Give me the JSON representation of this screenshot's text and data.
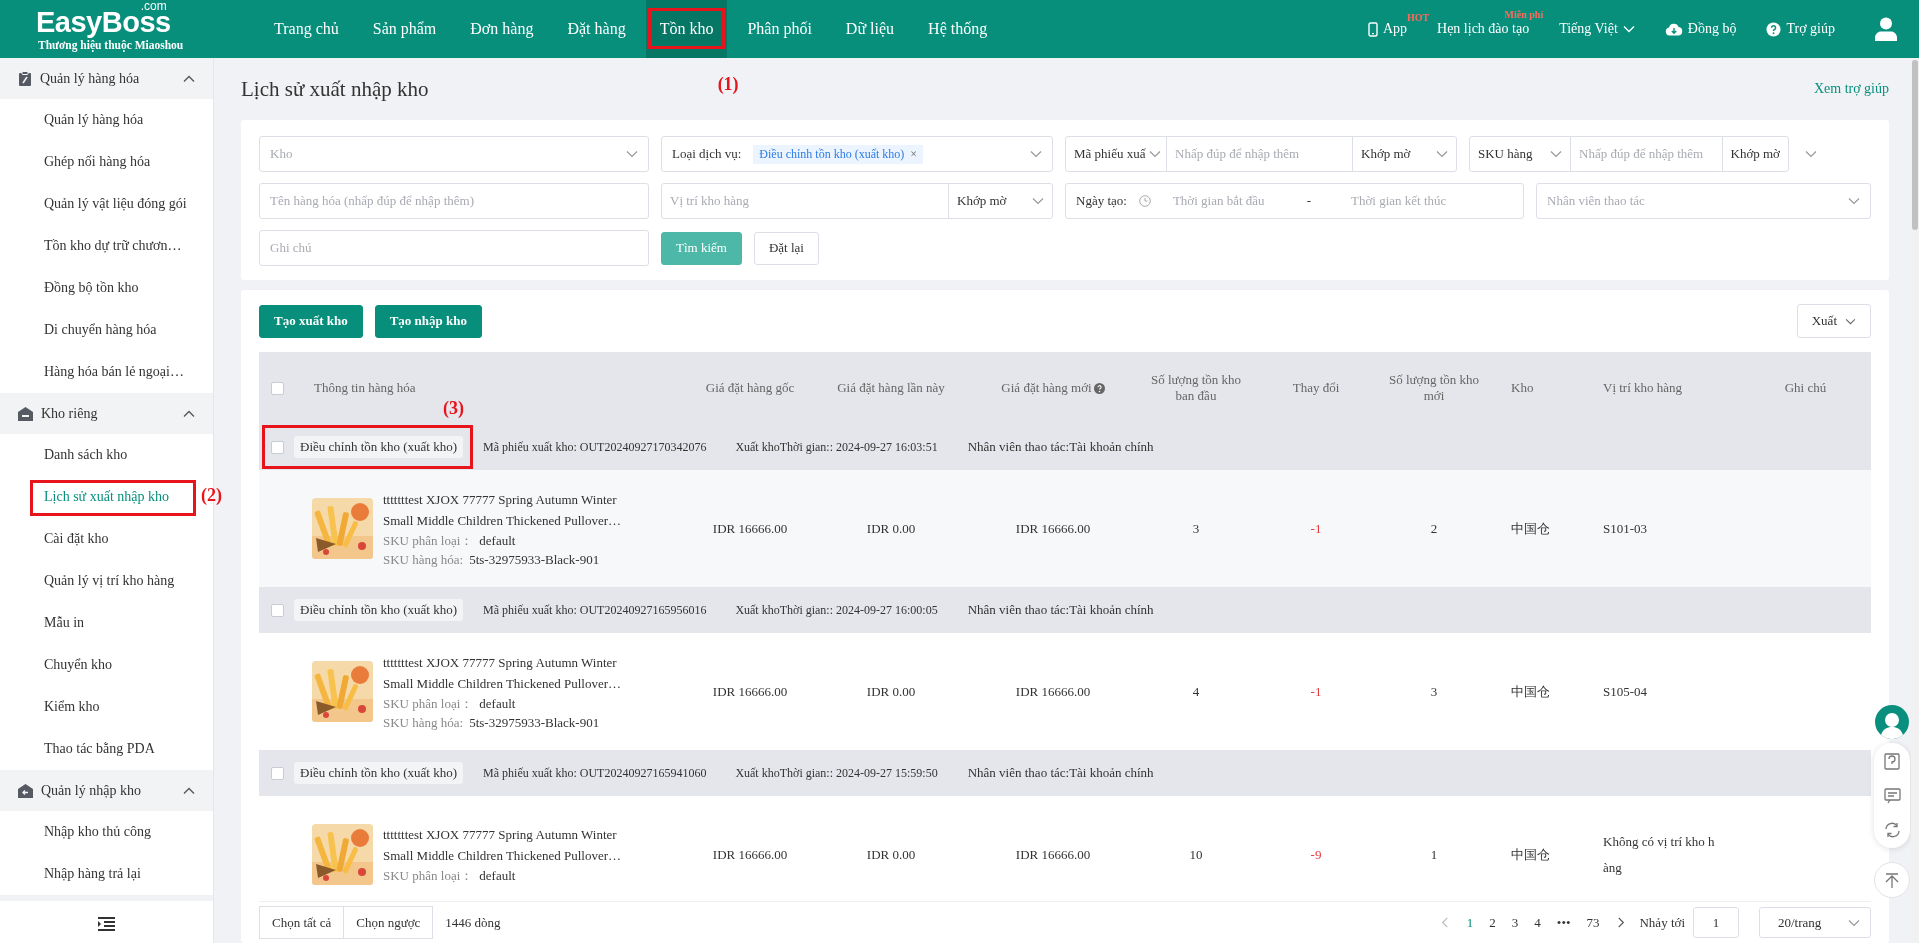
{
  "header": {
    "logo": "EasyBoss",
    "logo_suffix": ".com",
    "tagline": "Thương hiệu thuộc Miaoshou",
    "nav": [
      {
        "label": "Trang chủ",
        "selected": false
      },
      {
        "label": "Sản phẩm",
        "selected": false
      },
      {
        "label": "Đơn hàng",
        "selected": false
      },
      {
        "label": "Đặt hàng",
        "selected": false
      },
      {
        "label": "Tồn kho",
        "selected": true,
        "callout": "(1)"
      },
      {
        "label": "Phân phối",
        "selected": false
      },
      {
        "label": "Dữ liệu",
        "selected": false
      },
      {
        "label": "Hệ thống",
        "selected": false
      }
    ],
    "tools": [
      {
        "kind": "app",
        "label": "App",
        "badge": "HOT"
      },
      {
        "kind": "plain",
        "label": "Hẹn lịch đào tạo",
        "badge": "Miễn phí"
      },
      {
        "kind": "dropdown",
        "label": "Tiếng Việt"
      },
      {
        "kind": "sync",
        "label": "Đồng bộ"
      },
      {
        "kind": "help",
        "label": "Trợ giúp"
      }
    ]
  },
  "sidebar": {
    "groups": [
      {
        "kind": "goods",
        "label": "Quản lý hàng hóa",
        "expanded": true,
        "items": [
          {
            "label": "Quản lý hàng hóa",
            "selected": false
          },
          {
            "label": "Ghép nối hàng hóa",
            "selected": false
          },
          {
            "label": "Quản lý vật liệu đóng gói",
            "selected": false
          },
          {
            "label": "Tồn kho dự trữ chươn…",
            "selected": false
          },
          {
            "label": "Đồng bộ tồn kho",
            "selected": false
          },
          {
            "label": "Di chuyển hàng hóa",
            "selected": false
          },
          {
            "label": "Hàng hóa bán lẻ ngoại…",
            "selected": false
          }
        ]
      },
      {
        "kind": "warehouse",
        "label": "Kho riêng",
        "expanded": true,
        "items": [
          {
            "label": "Danh sách kho",
            "selected": false
          },
          {
            "label": "Lịch sử xuất nhập kho",
            "selected": true,
            "callout": "(2)"
          },
          {
            "label": "Cài đặt kho",
            "selected": false
          },
          {
            "label": "Quản lý vị trí kho hàng",
            "selected": false
          },
          {
            "label": "Mẫu in",
            "selected": false
          },
          {
            "label": "Chuyển kho",
            "selected": false
          },
          {
            "label": "Kiểm kho",
            "selected": false
          },
          {
            "label": "Thao tác bằng PDA",
            "selected": false
          }
        ]
      },
      {
        "kind": "inbound",
        "label": "Quản lý nhập kho",
        "expanded": true,
        "items": [
          {
            "label": "Nhập kho thủ công",
            "selected": false
          },
          {
            "label": "Nhập hàng trả lại",
            "selected": false
          }
        ]
      }
    ]
  },
  "page": {
    "title": "Lịch sử xuất nhập kho",
    "help_link": "Xem trợ giúp"
  },
  "filters": {
    "rows": [
      [
        {
          "kind": "select",
          "placeholder": "Kho"
        },
        {
          "kind": "tag-select",
          "label": "Loại dịch vụ:",
          "tag": "Điều chỉnh tồn kho (xuất kho)",
          "remove": "×"
        },
        {
          "kind": "combo",
          "field": "Mã phiếu xuấ",
          "placeholder": "Nhấp đúp để nhập thêm",
          "match": "Khớp mờ"
        },
        {
          "kind": "combo",
          "field": "SKU hàng",
          "placeholder": "Nhấp đúp để nhập thêm",
          "match": "Khớp mờ"
        }
      ],
      [
        {
          "kind": "input",
          "placeholder": "Tên hàng hóa (nhấp đúp để nhập thêm)"
        },
        {
          "kind": "input-match",
          "placeholder": "Vị trí kho hàng",
          "match": "Khớp mờ"
        },
        {
          "kind": "date-range",
          "label": "Ngày tạo:",
          "start": "Thời gian bắt đầu",
          "separator": "-",
          "end": "Thời gian kết thúc"
        },
        {
          "kind": "select",
          "placeholder": "Nhân viên thao tác"
        }
      ],
      [
        {
          "kind": "input",
          "placeholder": "Ghi chú"
        }
      ]
    ],
    "actions": [
      {
        "primary": true,
        "label": "Tìm kiếm"
      },
      {
        "primary": false,
        "label": "Đặt lại"
      }
    ]
  },
  "toolbar": {
    "buttons": [
      "Tạo xuất kho",
      "Tạo nhập kho"
    ],
    "export": "Xuất"
  },
  "table": {
    "header_checked": false,
    "columns": [
      {
        "label": "Thông tin hàng hóa"
      },
      {
        "label": "Giá đặt hàng gốc"
      },
      {
        "label": "Giá đặt hàng lần này"
      },
      {
        "label": "Giá đặt hàng mới",
        "hint_icon": true
      },
      {
        "label": "Số lượng tồn kho ban đầu"
      },
      {
        "label": "Thay đổi"
      },
      {
        "label": "Số lượng tồn kho mới"
      },
      {
        "label": "Kho"
      },
      {
        "label": "Vị trí kho hàng"
      },
      {
        "label": "Ghi chú"
      }
    ],
    "groups": [
      {
        "checked": false,
        "callout": "(3)",
        "type_tag": "Điều chỉnh tồn kho (xuất kho)",
        "order_no": "Mã phiếu xuất kho: OUT20240927170342076",
        "time": "Xuất khoThời gian:: 2024-09-27 16:03:51",
        "operator": "Nhân viên thao tác:Tài khoản chính",
        "item": {
          "name": "tttttttest XJOX 77777 Spring Autumn Winter Small Middle Children Thickened Pullover…",
          "variant_label": "SKU phân loại：",
          "variant": "default",
          "sku_label": "SKU hàng hóa:",
          "sku": "5ts-32975933-Black-901",
          "base_price": "IDR 16666.00",
          "last_price": "IDR 0.00",
          "new_price": "IDR 16666.00",
          "qty_before": "3",
          "change": "-1",
          "qty_after": "2",
          "warehouse": "中国仓",
          "location": "S101-03"
        }
      },
      {
        "checked": false,
        "type_tag": "Điều chỉnh tồn kho (xuất kho)",
        "order_no": "Mã phiếu xuất kho: OUT20240927165956016",
        "time": "Xuất khoThời gian:: 2024-09-27 16:00:05",
        "operator": "Nhân viên thao tác:Tài khoản chính",
        "item": {
          "name": "tttttttest XJOX 77777 Spring Autumn Winter Small Middle Children Thickened Pullover…",
          "variant_label": "SKU phân loại：",
          "variant": "default",
          "sku_label": "SKU hàng hóa:",
          "sku": "5ts-32975933-Black-901",
          "base_price": "IDR 16666.00",
          "last_price": "IDR 0.00",
          "new_price": "IDR 16666.00",
          "qty_before": "4",
          "change": "-1",
          "qty_after": "3",
          "warehouse": "中国仓",
          "location": "S105-04"
        }
      },
      {
        "checked": false,
        "type_tag": "Điều chỉnh tồn kho (xuất kho)",
        "order_no": "Mã phiếu xuất kho: OUT20240927165941060",
        "time": "Xuất khoThời gian:: 2024-09-27 15:59:50",
        "operator": "Nhân viên thao tác:Tài khoản chính",
        "item": {
          "name": "tttttttest XJOX 77777 Spring Autumn Winter Small Middle Children Thickened Pullover…",
          "variant_label": "SKU phân loại：",
          "variant": "default",
          "base_price": "IDR 16666.00",
          "last_price": "IDR 0.00",
          "new_price": "IDR 16666.00",
          "qty_before": "10",
          "change": "-9",
          "qty_after": "1",
          "warehouse": "中国仓",
          "location": "Không có vị trí kho hàng"
        }
      }
    ]
  },
  "footer": {
    "select_all": "Chọn tất cả",
    "invert": "Chọn ngược",
    "total": "1446 dòng",
    "pages": [
      {
        "label": "1",
        "selected": true
      },
      {
        "label": "2",
        "selected": false
      },
      {
        "label": "3",
        "selected": false
      },
      {
        "label": "4",
        "selected": false
      },
      {
        "label": "•••",
        "selected": false
      },
      {
        "label": "73",
        "selected": false
      }
    ],
    "jump_label": "Nhảy tới",
    "jump_value": "1",
    "page_size": "20/trang"
  }
}
